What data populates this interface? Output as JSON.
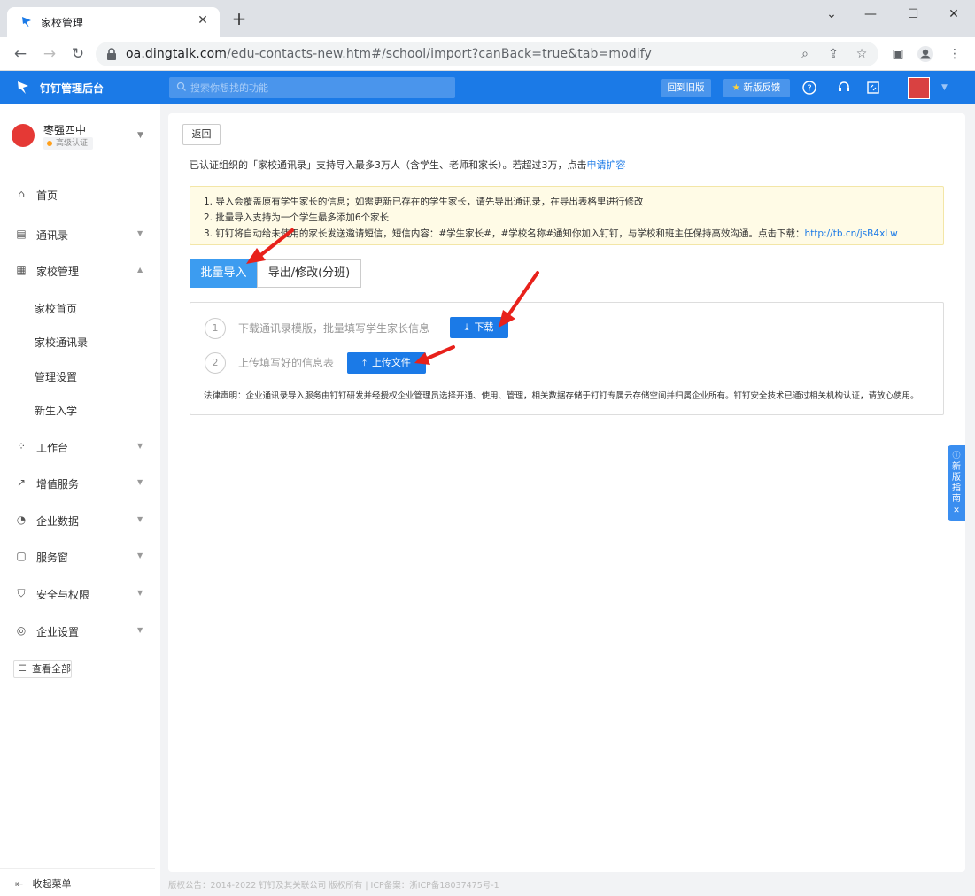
{
  "browser": {
    "tab_title": "家校管理",
    "url_host": "oa.dingtalk.com",
    "url_path": "/edu-contacts-new.htm#/school/import?canBack=true&tab=modify"
  },
  "app": {
    "name": "钉钉管理后台",
    "search_placeholder": "搜索你想找的功能",
    "old_version_label": "回到旧版",
    "feedback_label": "新版反馈",
    "brand_color": "#1b7ae7"
  },
  "sidebar": {
    "org_name": "枣强四中",
    "org_badge": "高级认证",
    "items": [
      {
        "label": "首页",
        "icon": "home-icon"
      },
      {
        "label": "通讯录",
        "icon": "contacts-icon"
      },
      {
        "label": "家校管理",
        "icon": "school-icon"
      },
      {
        "label": "工作台",
        "icon": "grid-icon"
      },
      {
        "label": "增值服务",
        "icon": "trend-icon"
      },
      {
        "label": "企业数据",
        "icon": "pie-chart-icon"
      },
      {
        "label": "服务窗",
        "icon": "window-icon"
      },
      {
        "label": "安全与权限",
        "icon": "shield-icon"
      },
      {
        "label": "企业设置",
        "icon": "settings-icon"
      }
    ],
    "sub_items": [
      "家校首页",
      "家校通讯录",
      "管理设置",
      "新生入学"
    ],
    "view_all": "查看全部",
    "collapse": "收起菜单"
  },
  "main": {
    "back_label": "返回",
    "info_text": "已认证组织的「家校通讯录」支持导入最多3万人（含学生、老师和家长）。若超过3万，点击",
    "info_link": "申请扩容",
    "notices": [
      "1. 导入会覆盖原有学生家长的信息；如需更新已存在的学生家长，请先导出通讯录，在导出表格里进行修改",
      "2. 批量导入支持为一个学生最多添加6个家长",
      "3. 钉钉将自动给未使用的家长发送邀请短信，短信内容：#学生家长#，#学校名称#通知你加入钉钉，与学校和班主任保持高效沟通。点击下载："
    ],
    "notice_link": "http://tb.cn/jsB4xLw",
    "tabs": [
      "批量导入",
      "导出/修改(分班)"
    ],
    "step1_num": "1",
    "step1_text": "下载通讯录模版，批量填写学生家长信息",
    "download_label": "下载",
    "step2_num": "2",
    "step2_text": "上传填写好的信息表",
    "upload_label": "上传文件",
    "legal": "法律声明：企业通讯录导入服务由钉钉研发并经授权企业管理员选择开通、使用、管理，相关数据存储于钉钉专属云存储空间并归属企业所有。钉钉安全技术已通过相关机构认证，请放心使用。"
  },
  "footer": "版权公告：2014-2022 钉钉及其关联公司 版权所有 | ICP备案：浙ICP备18037475号-1",
  "guide": {
    "label": "新版指南"
  }
}
